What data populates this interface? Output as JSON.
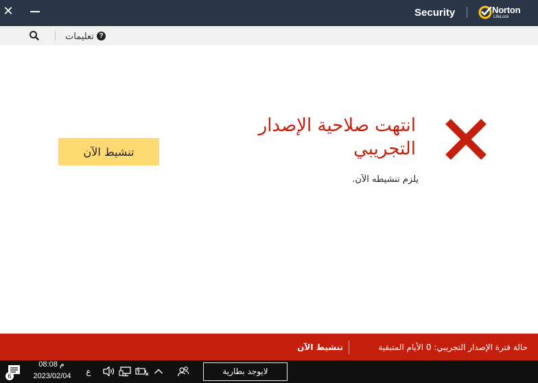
{
  "titlebar": {
    "product": "Security",
    "logo_name": "Norton",
    "logo_sub": "LifeLock"
  },
  "toolbar": {
    "help_label": "تعليمات",
    "help_icon_glyph": "?"
  },
  "main": {
    "headline": "انتهت صلاحية الإصدار التجريبي",
    "subtext": "يلزم تنشيطه الآن.",
    "activate_button": "تنشيط الآن"
  },
  "status_bar": {
    "trial_status": "حالة فترة الإصدار التجريبي:  0 الأيام المتبقية",
    "activate_link": "تنشيط الآن"
  },
  "taskbar": {
    "time": "08:08 م",
    "date": "2023/02/04",
    "language": "ع",
    "battery_tooltip": "لايوجد بطارية",
    "notification_count": "6"
  },
  "colors": {
    "titlebar": "#2a3547",
    "error_red": "#c41f0c",
    "button_yellow": "#ffd972",
    "logo_yellow": "#ffc20e",
    "taskbar": "#101010"
  },
  "icons": {
    "close": "close-icon",
    "minimize": "minimize-icon",
    "logo": "norton-check-icon",
    "search": "search-icon",
    "help": "help-icon",
    "error": "error-x-icon",
    "notifications": "notification-icon",
    "volume": "volume-icon",
    "network": "network-icon",
    "battery": "battery-icon",
    "show_hidden": "chevron-up-icon",
    "people": "people-icon"
  }
}
